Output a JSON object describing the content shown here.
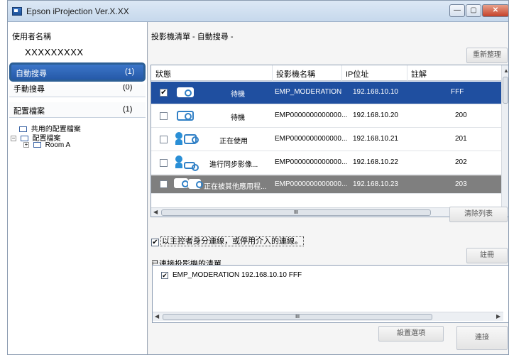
{
  "window": {
    "title": "Epson iProjection Ver.X.XX",
    "min_btn": "—",
    "max_btn": "▢",
    "close_btn": "✕"
  },
  "left_panel": {
    "user_name_label": "使用者名稱",
    "user_name_value": "XXXXXXXXX",
    "nav": [
      {
        "label": "自動搜尋",
        "count": "(1)",
        "selected": true
      },
      {
        "label": "手動搜尋",
        "count": "(0)",
        "selected": false
      },
      {
        "label": "配置檔案",
        "count": "(1)",
        "selected": false
      }
    ],
    "tree": [
      {
        "label": "共用的配置檔案",
        "level": 1
      },
      {
        "label": "配置檔案",
        "level": 0,
        "expander": "−"
      },
      {
        "label": "Room A",
        "level": 2,
        "expander": "+"
      }
    ]
  },
  "right_panel": {
    "heading": "投影機清單 - 自動搜尋 -",
    "refresh_button": "重新整理",
    "columns": [
      "狀態",
      "投影機名稱",
      "IP位址",
      "註解"
    ],
    "rows": [
      {
        "checked": true,
        "status": "待機",
        "name": "EMP_MODERATION",
        "ip": "192.168.10.10",
        "note": "FFF",
        "state": "selected"
      },
      {
        "checked": false,
        "status": "待機",
        "name": "EMP0000000000000...",
        "ip": "192.168.10.20",
        "note": "200",
        "state": "normal"
      },
      {
        "checked": false,
        "status": "正在使用",
        "name": "EMP0000000000000...",
        "ip": "192.168.10.21",
        "note": "201",
        "state": "normal"
      },
      {
        "checked": false,
        "status": "進行同步影像...",
        "name": "EMP0000000000000...",
        "ip": "192.168.10.22",
        "note": "202",
        "state": "normal"
      },
      {
        "checked": false,
        "status": "正在被其他應用程...",
        "name": "EMP0000000000000...",
        "ip": "192.168.10.23",
        "note": "203",
        "state": "busy"
      }
    ],
    "scroll_mark": "III",
    "clear_list_button": "清除列表",
    "moderator_checkbox_label": "以主控者身分連線，或停用介入的連線。",
    "moderator_checked": true,
    "register_button": "註冊",
    "connected_label": "已連接投影機的清單",
    "connected_items": [
      {
        "checked": true,
        "text": "EMP_MODERATION    192.168.10.10    FFF"
      }
    ],
    "settings_button": "設置選項",
    "connect_button": "連接"
  },
  "colors": {
    "selection": "#1f4fa0",
    "busy_row": "#7f7f7f",
    "nav_selected": "#3c76c9",
    "highlight_ring": "#2c5f95"
  }
}
